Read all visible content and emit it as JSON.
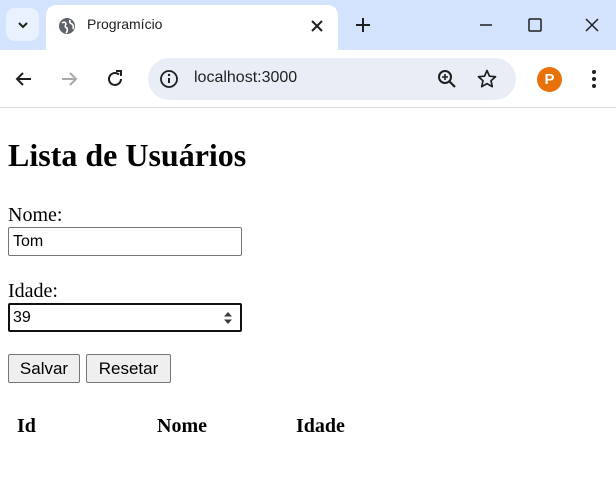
{
  "browser": {
    "tab_title": "Programício",
    "url": "localhost:3000",
    "profile_initial": "P",
    "profile_color": "#e8710a",
    "icons": [
      "tab-search-icon",
      "globe-icon",
      "close-icon",
      "plus-icon",
      "minimize-icon",
      "maximize-icon",
      "window-close-icon",
      "back-arrow-icon",
      "forward-arrow-icon",
      "reload-icon",
      "site-info-icon",
      "zoom-icon",
      "star-icon",
      "kebab-menu-icon"
    ]
  },
  "page": {
    "title": "Lista de Usuários",
    "form": {
      "name_label": "Nome:",
      "name_value": "Tom",
      "age_label": "Idade:",
      "age_value": "39",
      "save_label": "Salvar",
      "reset_label": "Resetar"
    },
    "table": {
      "headers": [
        "Id",
        "Nome",
        "Idade"
      ]
    }
  }
}
